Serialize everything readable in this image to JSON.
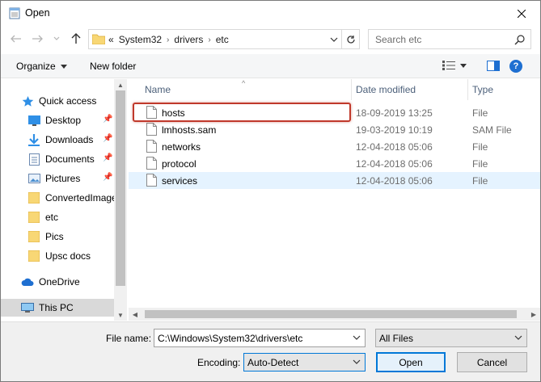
{
  "window": {
    "title": "Open"
  },
  "address": {
    "overflow": "«",
    "crumbs": [
      "System32",
      "drivers",
      "etc"
    ]
  },
  "search": {
    "placeholder": "Search etc"
  },
  "toolbar": {
    "organize": "Organize",
    "new_folder": "New folder"
  },
  "nav": {
    "items": [
      {
        "label": "Quick access",
        "icon": "star-icon"
      },
      {
        "label": "Desktop",
        "icon": "desktop-icon",
        "pinned": true
      },
      {
        "label": "Downloads",
        "icon": "download-icon",
        "pinned": true
      },
      {
        "label": "Documents",
        "icon": "document-icon",
        "pinned": true
      },
      {
        "label": "Pictures",
        "icon": "picture-icon",
        "pinned": true
      },
      {
        "label": "ConvertedImage",
        "icon": "folder-icon"
      },
      {
        "label": "etc",
        "icon": "folder-icon"
      },
      {
        "label": "Pics",
        "icon": "folder-icon"
      },
      {
        "label": "Upsc docs",
        "icon": "folder-icon"
      },
      {
        "label": "OneDrive",
        "icon": "cloud-icon"
      },
      {
        "label": "This PC",
        "icon": "computer-icon",
        "selected": true
      }
    ]
  },
  "files": {
    "columns": {
      "name": "Name",
      "date": "Date modified",
      "type": "Type"
    },
    "rows": [
      {
        "name": "hosts",
        "date": "18-09-2019 13:25",
        "type": "File"
      },
      {
        "name": "lmhosts.sam",
        "date": "19-03-2019 10:19",
        "type": "SAM File"
      },
      {
        "name": "networks",
        "date": "12-04-2018 05:06",
        "type": "File"
      },
      {
        "name": "protocol",
        "date": "12-04-2018 05:06",
        "type": "File"
      },
      {
        "name": "services",
        "date": "12-04-2018 05:06",
        "type": "File"
      }
    ]
  },
  "bottom": {
    "filename_label": "File name:",
    "filename_value": "C:\\Windows\\System32\\drivers\\etc",
    "filetype_value": "All Files",
    "encoding_label": "Encoding:",
    "encoding_value": "Auto-Detect",
    "open_label": "Open",
    "cancel_label": "Cancel"
  },
  "colors": {
    "accent": "#0078d7",
    "highlight": "#c0392b",
    "folder": "#f8d775"
  }
}
